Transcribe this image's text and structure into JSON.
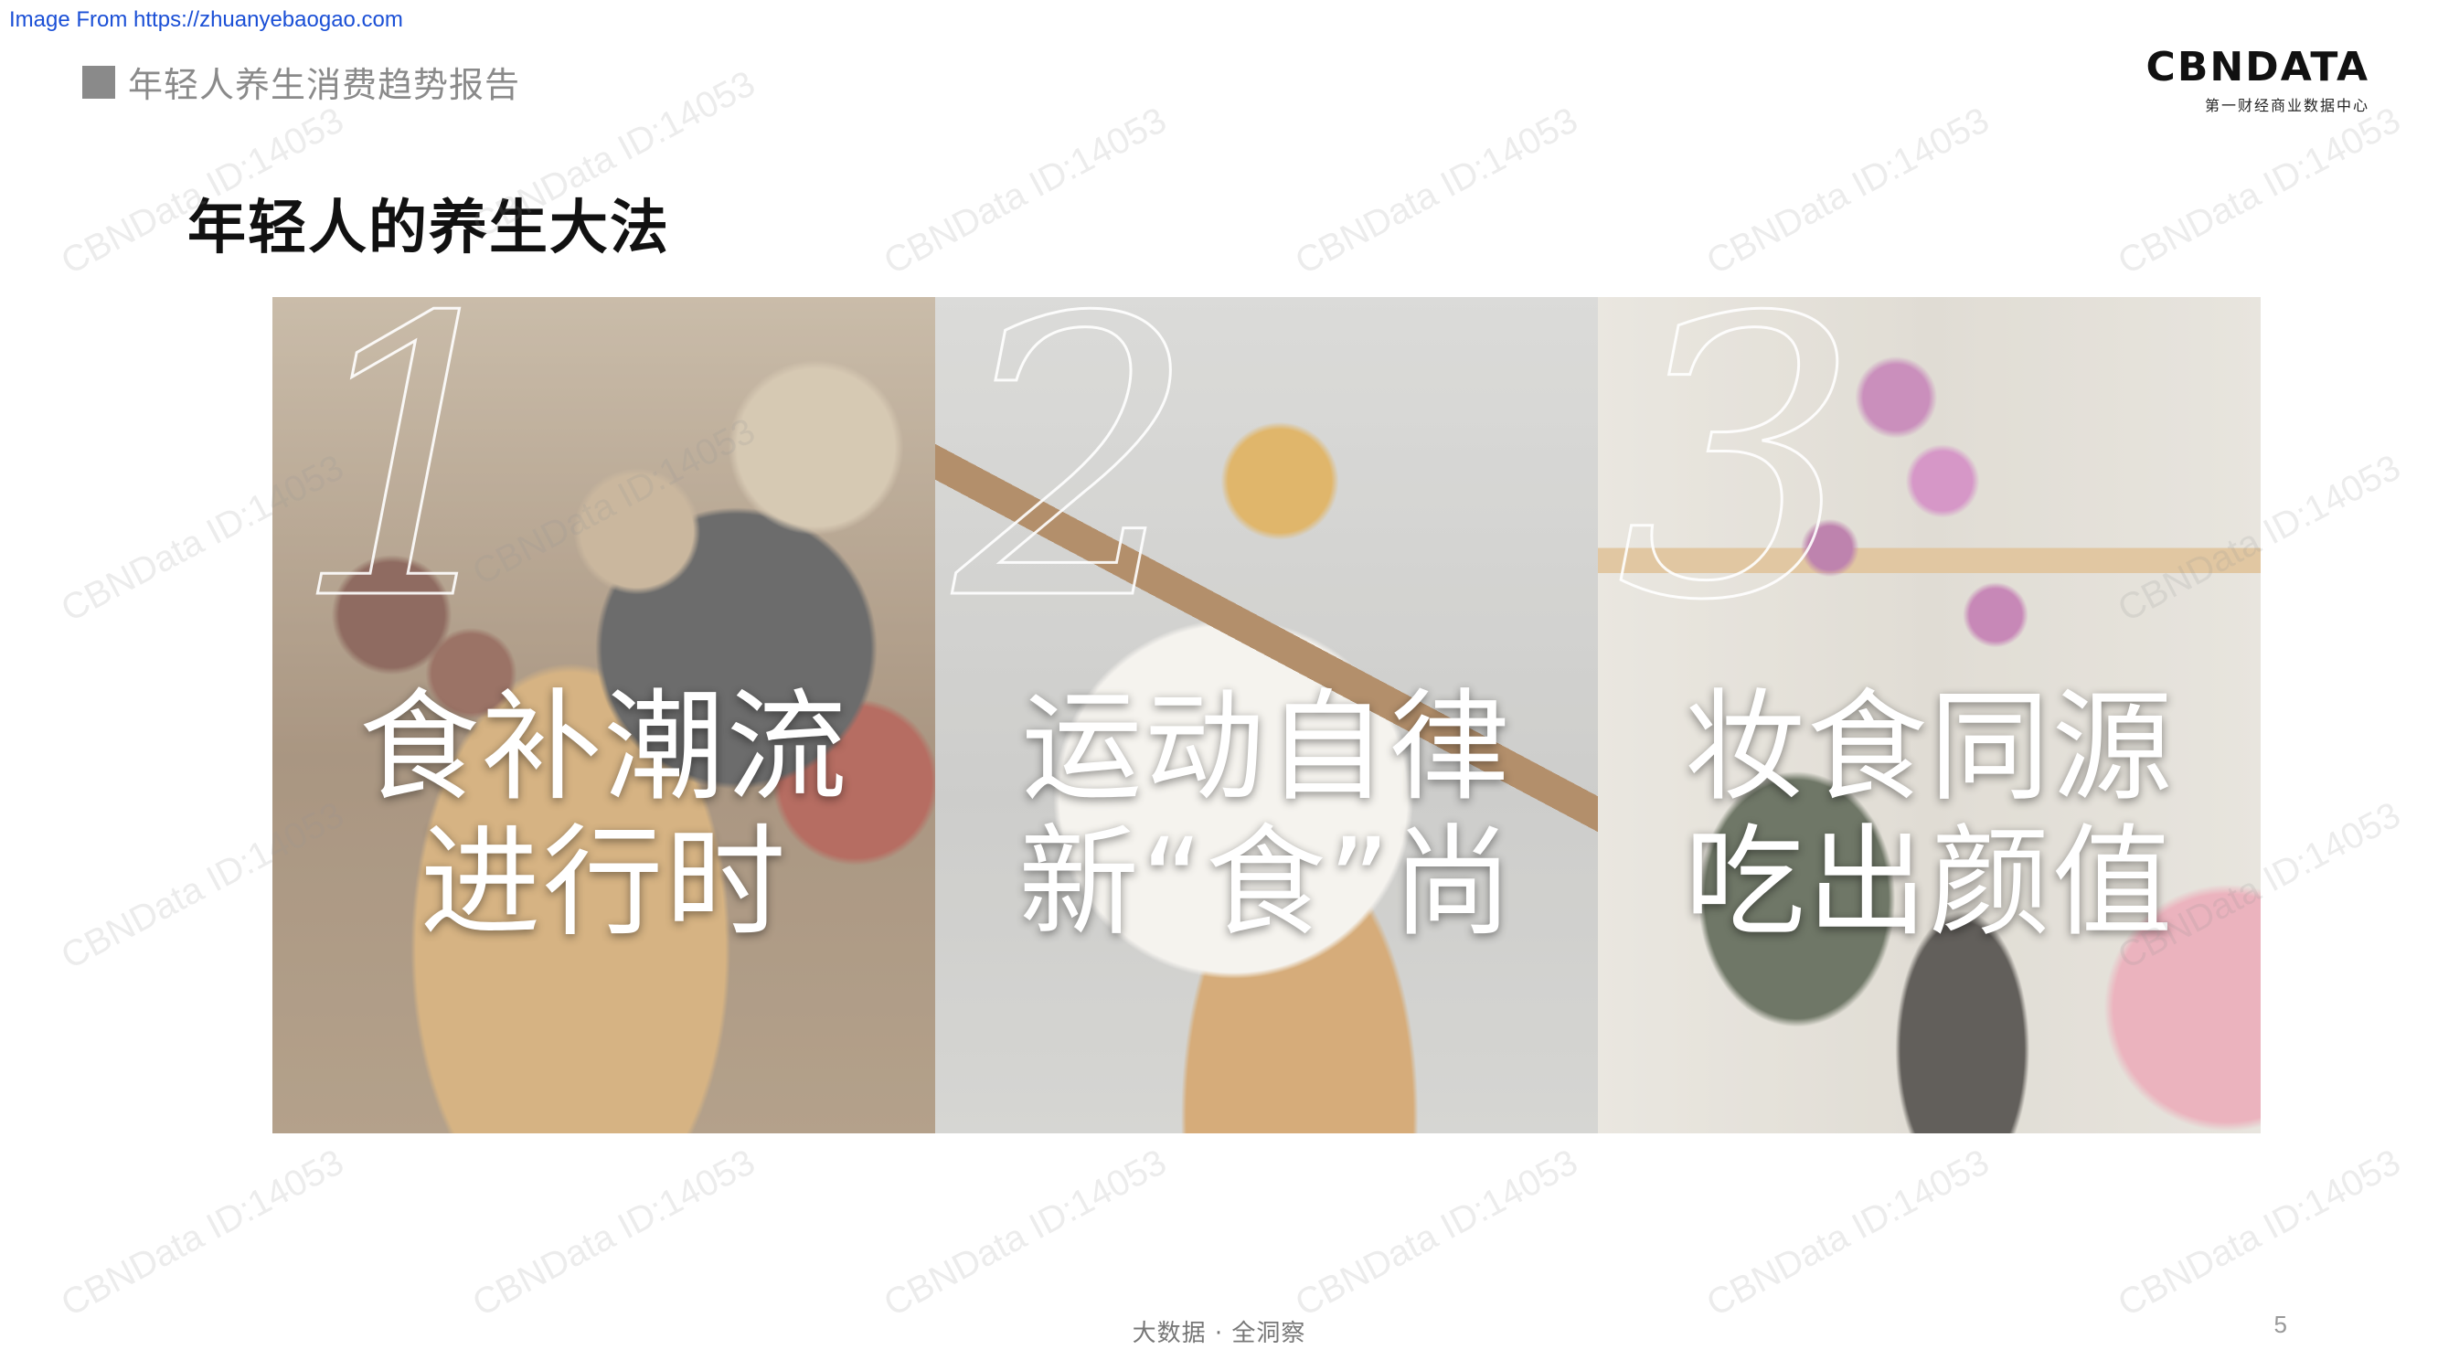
{
  "source": {
    "text": "Image From https://zhuanyebaogao.com"
  },
  "header": {
    "report_title": "年轻人养生消费趋势报告"
  },
  "logo": {
    "main": "CBNDATA",
    "sub": "第一财经商业数据中心"
  },
  "page": {
    "heading": "年轻人的养生大法"
  },
  "panels": [
    {
      "number": "1",
      "line1": "食补潮流",
      "line2": "进行时"
    },
    {
      "number": "2",
      "line1": "运动自律",
      "line2": "新“食”尚"
    },
    {
      "number": "3",
      "line1": "妆食同源",
      "line2": "吃出颜值"
    }
  ],
  "watermark": {
    "text": "CBNData ID:14053"
  },
  "footer": {
    "text": "大数据 · 全洞察",
    "page_number": "5"
  },
  "colors": {
    "header_gray": "#8a8a8a",
    "link_blue": "#1a4fd6",
    "heading": "#111111"
  }
}
